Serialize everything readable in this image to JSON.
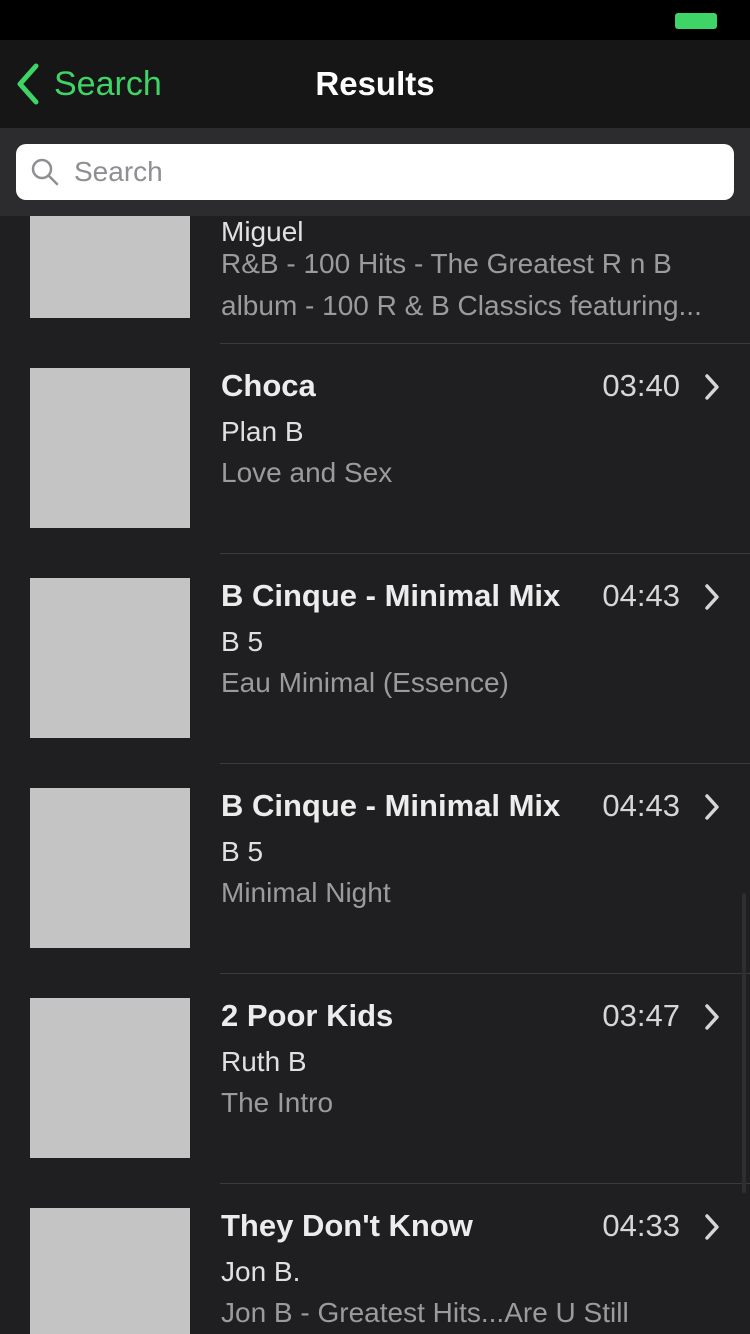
{
  "nav": {
    "back_label": "Search",
    "title": "Results"
  },
  "search": {
    "placeholder": "Search",
    "value": ""
  },
  "results": [
    {
      "artist": "Miguel",
      "album": "R&B - 100 Hits - The Greatest R n B album - 100 R & B Classics featuring..."
    },
    {
      "title": "Choca",
      "duration": "03:40",
      "artist": "Plan B",
      "album": "Love and Sex"
    },
    {
      "title": "B Cinque - Minimal Mix",
      "duration": "04:43",
      "artist": "B 5",
      "album": "Eau Minimal (Essence)"
    },
    {
      "title": "B Cinque - Minimal Mix",
      "duration": "04:43",
      "artist": "B 5",
      "album": "Minimal Night"
    },
    {
      "title": "2 Poor Kids",
      "duration": "03:47",
      "artist": "Ruth B",
      "album": "The Intro"
    },
    {
      "title": "They Don't Know",
      "duration": "04:33",
      "artist": "Jon B.",
      "album": "Jon B - Greatest Hits...Are U Still"
    }
  ],
  "colors": {
    "accent": "#3fd466",
    "background": "#1f1f21",
    "navbar": "#161616",
    "thumbnail": "#c4c4c4"
  },
  "icons": {
    "back": "chevron-left-icon",
    "search": "magnifier-icon",
    "disclosure": "chevron-right-icon"
  }
}
